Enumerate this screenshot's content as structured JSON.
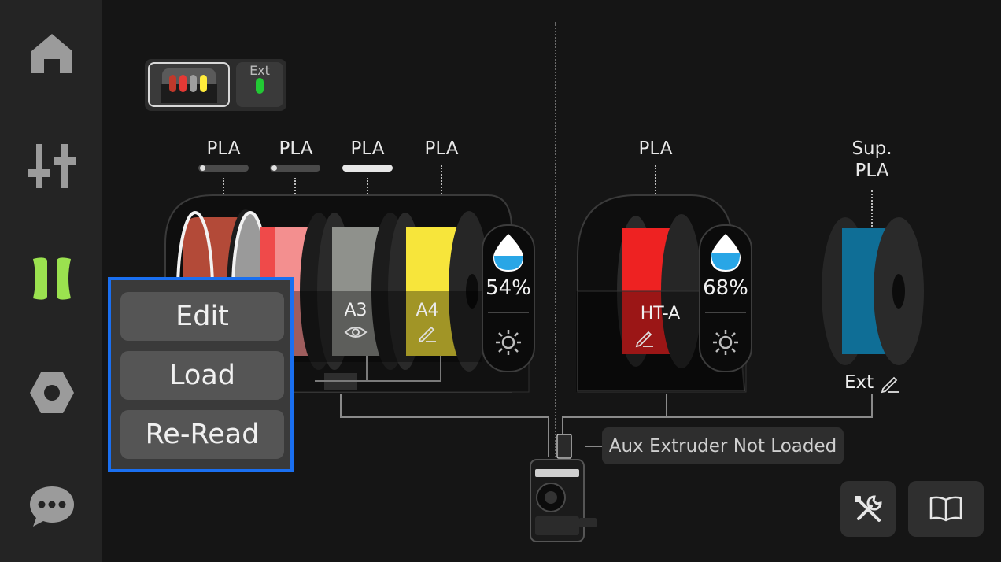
{
  "sidebar": {
    "items": [
      {
        "name": "home",
        "icon": "home-icon"
      },
      {
        "name": "controls",
        "icon": "sliders-icon"
      },
      {
        "name": "filament",
        "icon": "filament-icon",
        "active": true,
        "active_color": "#9be24f"
      },
      {
        "name": "settings",
        "icon": "hex-nut-icon"
      },
      {
        "name": "messages",
        "icon": "chat-icon"
      }
    ]
  },
  "unit_tabs": {
    "ams_tab": {
      "colors": [
        "#c0392b",
        "#e53935",
        "#9e9e9e",
        "#ffeb3b"
      ],
      "selected": true
    },
    "ext_tab": {
      "label": "Ext",
      "color": "#22c934"
    }
  },
  "ams": {
    "slots": [
      {
        "material": "PLA",
        "color": "#b34a38",
        "label": "",
        "progress_level": 0.05
      },
      {
        "material": "PLA",
        "color": "#ef4a4a",
        "label": "",
        "progress_level": 0.05
      },
      {
        "material": "PLA",
        "color": "#8f918c",
        "label": "A3",
        "icon": "eye-icon",
        "progress_level": 1.0
      },
      {
        "material": "PLA",
        "color": "#f7e53b",
        "label": "A4",
        "icon": "pencil-icon",
        "progress_level": null
      }
    ],
    "humidity": "54%",
    "humidity_level": 0.54
  },
  "ht_unit": {
    "material": "PLA",
    "color": "#ee2222",
    "label": "HT-A",
    "icon": "pencil-icon",
    "humidity": "68%",
    "humidity_level": 0.68
  },
  "external": {
    "material_line1": "Sup.",
    "material_line2": "PLA",
    "color": "#0f6e96",
    "label": "Ext"
  },
  "context_menu": {
    "edit": "Edit",
    "load": "Load",
    "reread": "Re-Read"
  },
  "status": {
    "aux_extruder": "Aux Extruder Not Loaded"
  },
  "accent_color": "#1a6ff0"
}
